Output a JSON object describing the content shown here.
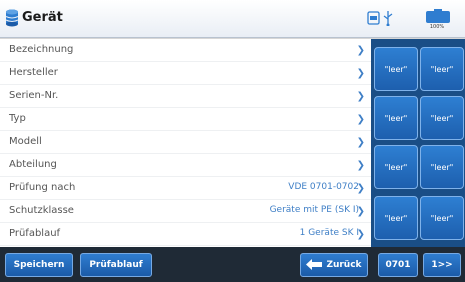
{
  "header": {
    "title": "Gerät",
    "battery_text": "100%",
    "icons": [
      "database-icon",
      "sd-card-icon",
      "usb-icon",
      "battery-icon"
    ]
  },
  "fields": [
    {
      "label": "Bezeichnung",
      "value": ""
    },
    {
      "label": "Hersteller",
      "value": ""
    },
    {
      "label": "Serien-Nr.",
      "value": ""
    },
    {
      "label": "Typ",
      "value": ""
    },
    {
      "label": "Modell",
      "value": ""
    },
    {
      "label": "Abteilung",
      "value": ""
    },
    {
      "label": "Prüfung nach",
      "value": "VDE 0701-0702"
    },
    {
      "label": "Schutzklasse",
      "value": "Geräte mit PE (SK I)"
    },
    {
      "label": "Prüfablauf",
      "value": "1 Geräte SK I"
    }
  ],
  "side_buttons": [
    "\"leer\"",
    "\"leer\"",
    "\"leer\"",
    "\"leer\"",
    "\"leer\"",
    "\"leer\"",
    "\"leer\"",
    "\"leer\""
  ],
  "toolbar": {
    "save": "Speichern",
    "workflow": "Prüfablauf",
    "back": "Zurück",
    "code": "0701",
    "next": "1>>"
  },
  "colors": {
    "accent": "#2f7dd0",
    "value_text": "#3f7fc6",
    "panel": "#1a4e86",
    "toolbar": "#1f2a36"
  }
}
